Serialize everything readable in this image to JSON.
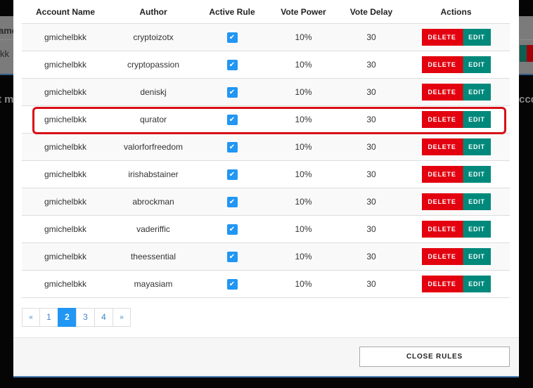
{
  "background": {
    "header_fragment": "ame",
    "row_fragment": "kk",
    "left_text_fragment": "t m",
    "right_text_fragment": "ccc"
  },
  "table": {
    "columns": [
      "Account Name",
      "Author",
      "Active Rule",
      "Vote Power",
      "Vote Delay",
      "Actions"
    ],
    "rows": [
      {
        "account": "gmichelbkk",
        "author": "cryptoizotx",
        "active": true,
        "vote_power": "10%",
        "vote_delay": "30"
      },
      {
        "account": "gmichelbkk",
        "author": "cryptopassion",
        "active": true,
        "vote_power": "10%",
        "vote_delay": "30"
      },
      {
        "account": "gmichelbkk",
        "author": "deniskj",
        "active": true,
        "vote_power": "10%",
        "vote_delay": "30"
      },
      {
        "account": "gmichelbkk",
        "author": "qurator",
        "active": true,
        "vote_power": "10%",
        "vote_delay": "30",
        "highlighted": true
      },
      {
        "account": "gmichelbkk",
        "author": "valorforfreedom",
        "active": true,
        "vote_power": "10%",
        "vote_delay": "30"
      },
      {
        "account": "gmichelbkk",
        "author": "irishabstainer",
        "active": true,
        "vote_power": "10%",
        "vote_delay": "30"
      },
      {
        "account": "gmichelbkk",
        "author": "abrockman",
        "active": true,
        "vote_power": "10%",
        "vote_delay": "30"
      },
      {
        "account": "gmichelbkk",
        "author": "vaderiffic",
        "active": true,
        "vote_power": "10%",
        "vote_delay": "30"
      },
      {
        "account": "gmichelbkk",
        "author": "theessential",
        "active": true,
        "vote_power": "10%",
        "vote_delay": "30"
      },
      {
        "account": "gmichelbkk",
        "author": "mayasiam",
        "active": true,
        "vote_power": "10%",
        "vote_delay": "30"
      }
    ],
    "delete_label": "DELETE",
    "edit_label": "EDIT",
    "checkbox_glyph": "✔"
  },
  "pagination": {
    "prev": "«",
    "pages": [
      "1",
      "2",
      "3",
      "4"
    ],
    "current": "2",
    "next": "»"
  },
  "footer": {
    "close_label": "CLOSE RULES"
  },
  "colors": {
    "delete": "#e3000f",
    "edit": "#00897b",
    "checkbox": "#2196f3",
    "highlight": "#d80f17",
    "active_page": "#2196f3"
  }
}
